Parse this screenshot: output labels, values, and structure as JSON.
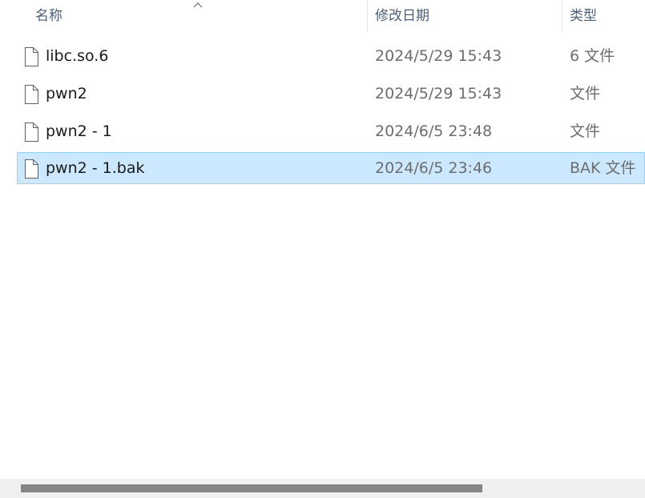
{
  "columns": {
    "name": "名称",
    "date": "修改日期",
    "type": "类型"
  },
  "sort": {
    "column": "name",
    "direction": "ascending",
    "icon": "sort-up-icon"
  },
  "files": [
    {
      "name": "libc.so.6",
      "date": "2024/5/29 15:43",
      "type": "6 文件",
      "icon": "file-icon",
      "selected": false
    },
    {
      "name": "pwn2",
      "date": "2024/5/29 15:43",
      "type": "文件",
      "icon": "file-icon",
      "selected": false
    },
    {
      "name": "pwn2 - 1",
      "date": "2024/6/5 23:48",
      "type": "文件",
      "icon": "file-icon",
      "selected": false
    },
    {
      "name": "pwn2 - 1.bak",
      "date": "2024/6/5 23:46",
      "type": "BAK 文件",
      "icon": "file-icon",
      "selected": true
    }
  ],
  "colors": {
    "selection_bg": "#cce8ff",
    "selection_border": "#99d1ff",
    "header_text": "#4c607a",
    "secondary_text": "#6d6d6d"
  }
}
